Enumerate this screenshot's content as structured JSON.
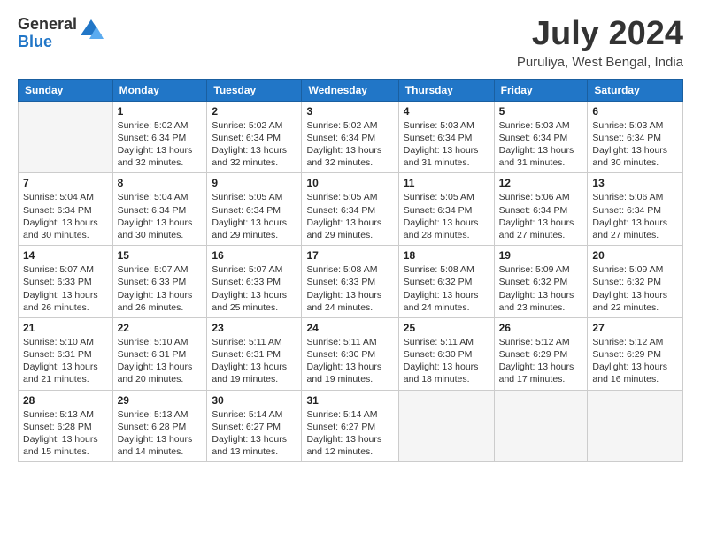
{
  "header": {
    "logo_general": "General",
    "logo_blue": "Blue",
    "month_title": "July 2024",
    "location": "Puruliya, West Bengal, India"
  },
  "days_of_week": [
    "Sunday",
    "Monday",
    "Tuesday",
    "Wednesday",
    "Thursday",
    "Friday",
    "Saturday"
  ],
  "weeks": [
    [
      {
        "num": "",
        "sunrise": "",
        "sunset": "",
        "daylight": ""
      },
      {
        "num": "1",
        "sunrise": "Sunrise: 5:02 AM",
        "sunset": "Sunset: 6:34 PM",
        "daylight": "Daylight: 13 hours and 32 minutes."
      },
      {
        "num": "2",
        "sunrise": "Sunrise: 5:02 AM",
        "sunset": "Sunset: 6:34 PM",
        "daylight": "Daylight: 13 hours and 32 minutes."
      },
      {
        "num": "3",
        "sunrise": "Sunrise: 5:02 AM",
        "sunset": "Sunset: 6:34 PM",
        "daylight": "Daylight: 13 hours and 32 minutes."
      },
      {
        "num": "4",
        "sunrise": "Sunrise: 5:03 AM",
        "sunset": "Sunset: 6:34 PM",
        "daylight": "Daylight: 13 hours and 31 minutes."
      },
      {
        "num": "5",
        "sunrise": "Sunrise: 5:03 AM",
        "sunset": "Sunset: 6:34 PM",
        "daylight": "Daylight: 13 hours and 31 minutes."
      },
      {
        "num": "6",
        "sunrise": "Sunrise: 5:03 AM",
        "sunset": "Sunset: 6:34 PM",
        "daylight": "Daylight: 13 hours and 30 minutes."
      }
    ],
    [
      {
        "num": "7",
        "sunrise": "Sunrise: 5:04 AM",
        "sunset": "Sunset: 6:34 PM",
        "daylight": "Daylight: 13 hours and 30 minutes."
      },
      {
        "num": "8",
        "sunrise": "Sunrise: 5:04 AM",
        "sunset": "Sunset: 6:34 PM",
        "daylight": "Daylight: 13 hours and 30 minutes."
      },
      {
        "num": "9",
        "sunrise": "Sunrise: 5:05 AM",
        "sunset": "Sunset: 6:34 PM",
        "daylight": "Daylight: 13 hours and 29 minutes."
      },
      {
        "num": "10",
        "sunrise": "Sunrise: 5:05 AM",
        "sunset": "Sunset: 6:34 PM",
        "daylight": "Daylight: 13 hours and 29 minutes."
      },
      {
        "num": "11",
        "sunrise": "Sunrise: 5:05 AM",
        "sunset": "Sunset: 6:34 PM",
        "daylight": "Daylight: 13 hours and 28 minutes."
      },
      {
        "num": "12",
        "sunrise": "Sunrise: 5:06 AM",
        "sunset": "Sunset: 6:34 PM",
        "daylight": "Daylight: 13 hours and 27 minutes."
      },
      {
        "num": "13",
        "sunrise": "Sunrise: 5:06 AM",
        "sunset": "Sunset: 6:34 PM",
        "daylight": "Daylight: 13 hours and 27 minutes."
      }
    ],
    [
      {
        "num": "14",
        "sunrise": "Sunrise: 5:07 AM",
        "sunset": "Sunset: 6:33 PM",
        "daylight": "Daylight: 13 hours and 26 minutes."
      },
      {
        "num": "15",
        "sunrise": "Sunrise: 5:07 AM",
        "sunset": "Sunset: 6:33 PM",
        "daylight": "Daylight: 13 hours and 26 minutes."
      },
      {
        "num": "16",
        "sunrise": "Sunrise: 5:07 AM",
        "sunset": "Sunset: 6:33 PM",
        "daylight": "Daylight: 13 hours and 25 minutes."
      },
      {
        "num": "17",
        "sunrise": "Sunrise: 5:08 AM",
        "sunset": "Sunset: 6:33 PM",
        "daylight": "Daylight: 13 hours and 24 minutes."
      },
      {
        "num": "18",
        "sunrise": "Sunrise: 5:08 AM",
        "sunset": "Sunset: 6:32 PM",
        "daylight": "Daylight: 13 hours and 24 minutes."
      },
      {
        "num": "19",
        "sunrise": "Sunrise: 5:09 AM",
        "sunset": "Sunset: 6:32 PM",
        "daylight": "Daylight: 13 hours and 23 minutes."
      },
      {
        "num": "20",
        "sunrise": "Sunrise: 5:09 AM",
        "sunset": "Sunset: 6:32 PM",
        "daylight": "Daylight: 13 hours and 22 minutes."
      }
    ],
    [
      {
        "num": "21",
        "sunrise": "Sunrise: 5:10 AM",
        "sunset": "Sunset: 6:31 PM",
        "daylight": "Daylight: 13 hours and 21 minutes."
      },
      {
        "num": "22",
        "sunrise": "Sunrise: 5:10 AM",
        "sunset": "Sunset: 6:31 PM",
        "daylight": "Daylight: 13 hours and 20 minutes."
      },
      {
        "num": "23",
        "sunrise": "Sunrise: 5:11 AM",
        "sunset": "Sunset: 6:31 PM",
        "daylight": "Daylight: 13 hours and 19 minutes."
      },
      {
        "num": "24",
        "sunrise": "Sunrise: 5:11 AM",
        "sunset": "Sunset: 6:30 PM",
        "daylight": "Daylight: 13 hours and 19 minutes."
      },
      {
        "num": "25",
        "sunrise": "Sunrise: 5:11 AM",
        "sunset": "Sunset: 6:30 PM",
        "daylight": "Daylight: 13 hours and 18 minutes."
      },
      {
        "num": "26",
        "sunrise": "Sunrise: 5:12 AM",
        "sunset": "Sunset: 6:29 PM",
        "daylight": "Daylight: 13 hours and 17 minutes."
      },
      {
        "num": "27",
        "sunrise": "Sunrise: 5:12 AM",
        "sunset": "Sunset: 6:29 PM",
        "daylight": "Daylight: 13 hours and 16 minutes."
      }
    ],
    [
      {
        "num": "28",
        "sunrise": "Sunrise: 5:13 AM",
        "sunset": "Sunset: 6:28 PM",
        "daylight": "Daylight: 13 hours and 15 minutes."
      },
      {
        "num": "29",
        "sunrise": "Sunrise: 5:13 AM",
        "sunset": "Sunset: 6:28 PM",
        "daylight": "Daylight: 13 hours and 14 minutes."
      },
      {
        "num": "30",
        "sunrise": "Sunrise: 5:14 AM",
        "sunset": "Sunset: 6:27 PM",
        "daylight": "Daylight: 13 hours and 13 minutes."
      },
      {
        "num": "31",
        "sunrise": "Sunrise: 5:14 AM",
        "sunset": "Sunset: 6:27 PM",
        "daylight": "Daylight: 13 hours and 12 minutes."
      },
      {
        "num": "",
        "sunrise": "",
        "sunset": "",
        "daylight": ""
      },
      {
        "num": "",
        "sunrise": "",
        "sunset": "",
        "daylight": ""
      },
      {
        "num": "",
        "sunrise": "",
        "sunset": "",
        "daylight": ""
      }
    ]
  ]
}
